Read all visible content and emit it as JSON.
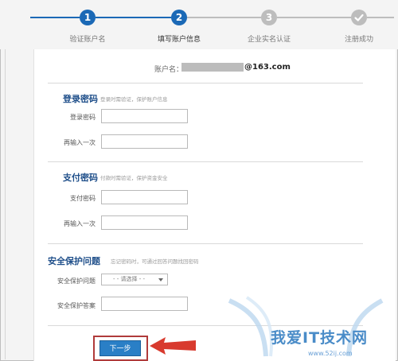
{
  "stepper": {
    "steps": [
      {
        "number": "1",
        "label": "验证账户名",
        "status": "done"
      },
      {
        "number": "2",
        "label": "填写账户信息",
        "status": "active"
      },
      {
        "number": "3",
        "label": "企业实名认证",
        "status": "todo"
      },
      {
        "number": "",
        "label": "注册成功",
        "status": "todo",
        "icon": "check-icon"
      }
    ],
    "colors": {
      "active": "#1b69b6",
      "inactive": "#bdbdbd"
    }
  },
  "account": {
    "label": "账户名：",
    "domain": "@163.com"
  },
  "login_section": {
    "title": "登录密码",
    "hint": "登录时需验证，保护账户信息",
    "password_label": "登录密码",
    "confirm_label": "再输入一次",
    "password_value": "",
    "confirm_value": ""
  },
  "pay_section": {
    "title": "支付密码",
    "hint": "付款时需验证，保护资金安全",
    "password_label": "支付密码",
    "confirm_label": "再输入一次",
    "password_value": "",
    "confirm_value": ""
  },
  "security_section": {
    "title": "安全保护问题",
    "hint": "忘记密码时，可通过回答问题找回密码",
    "question_label": "安全保护问题",
    "question_selected": "- - 请选择 - -",
    "answer_label": "安全保护答案",
    "answer_value": ""
  },
  "actions": {
    "next_label": "下一步"
  },
  "watermark": {
    "title": "我爱IT技术网",
    "url": "www.52ij.com"
  }
}
